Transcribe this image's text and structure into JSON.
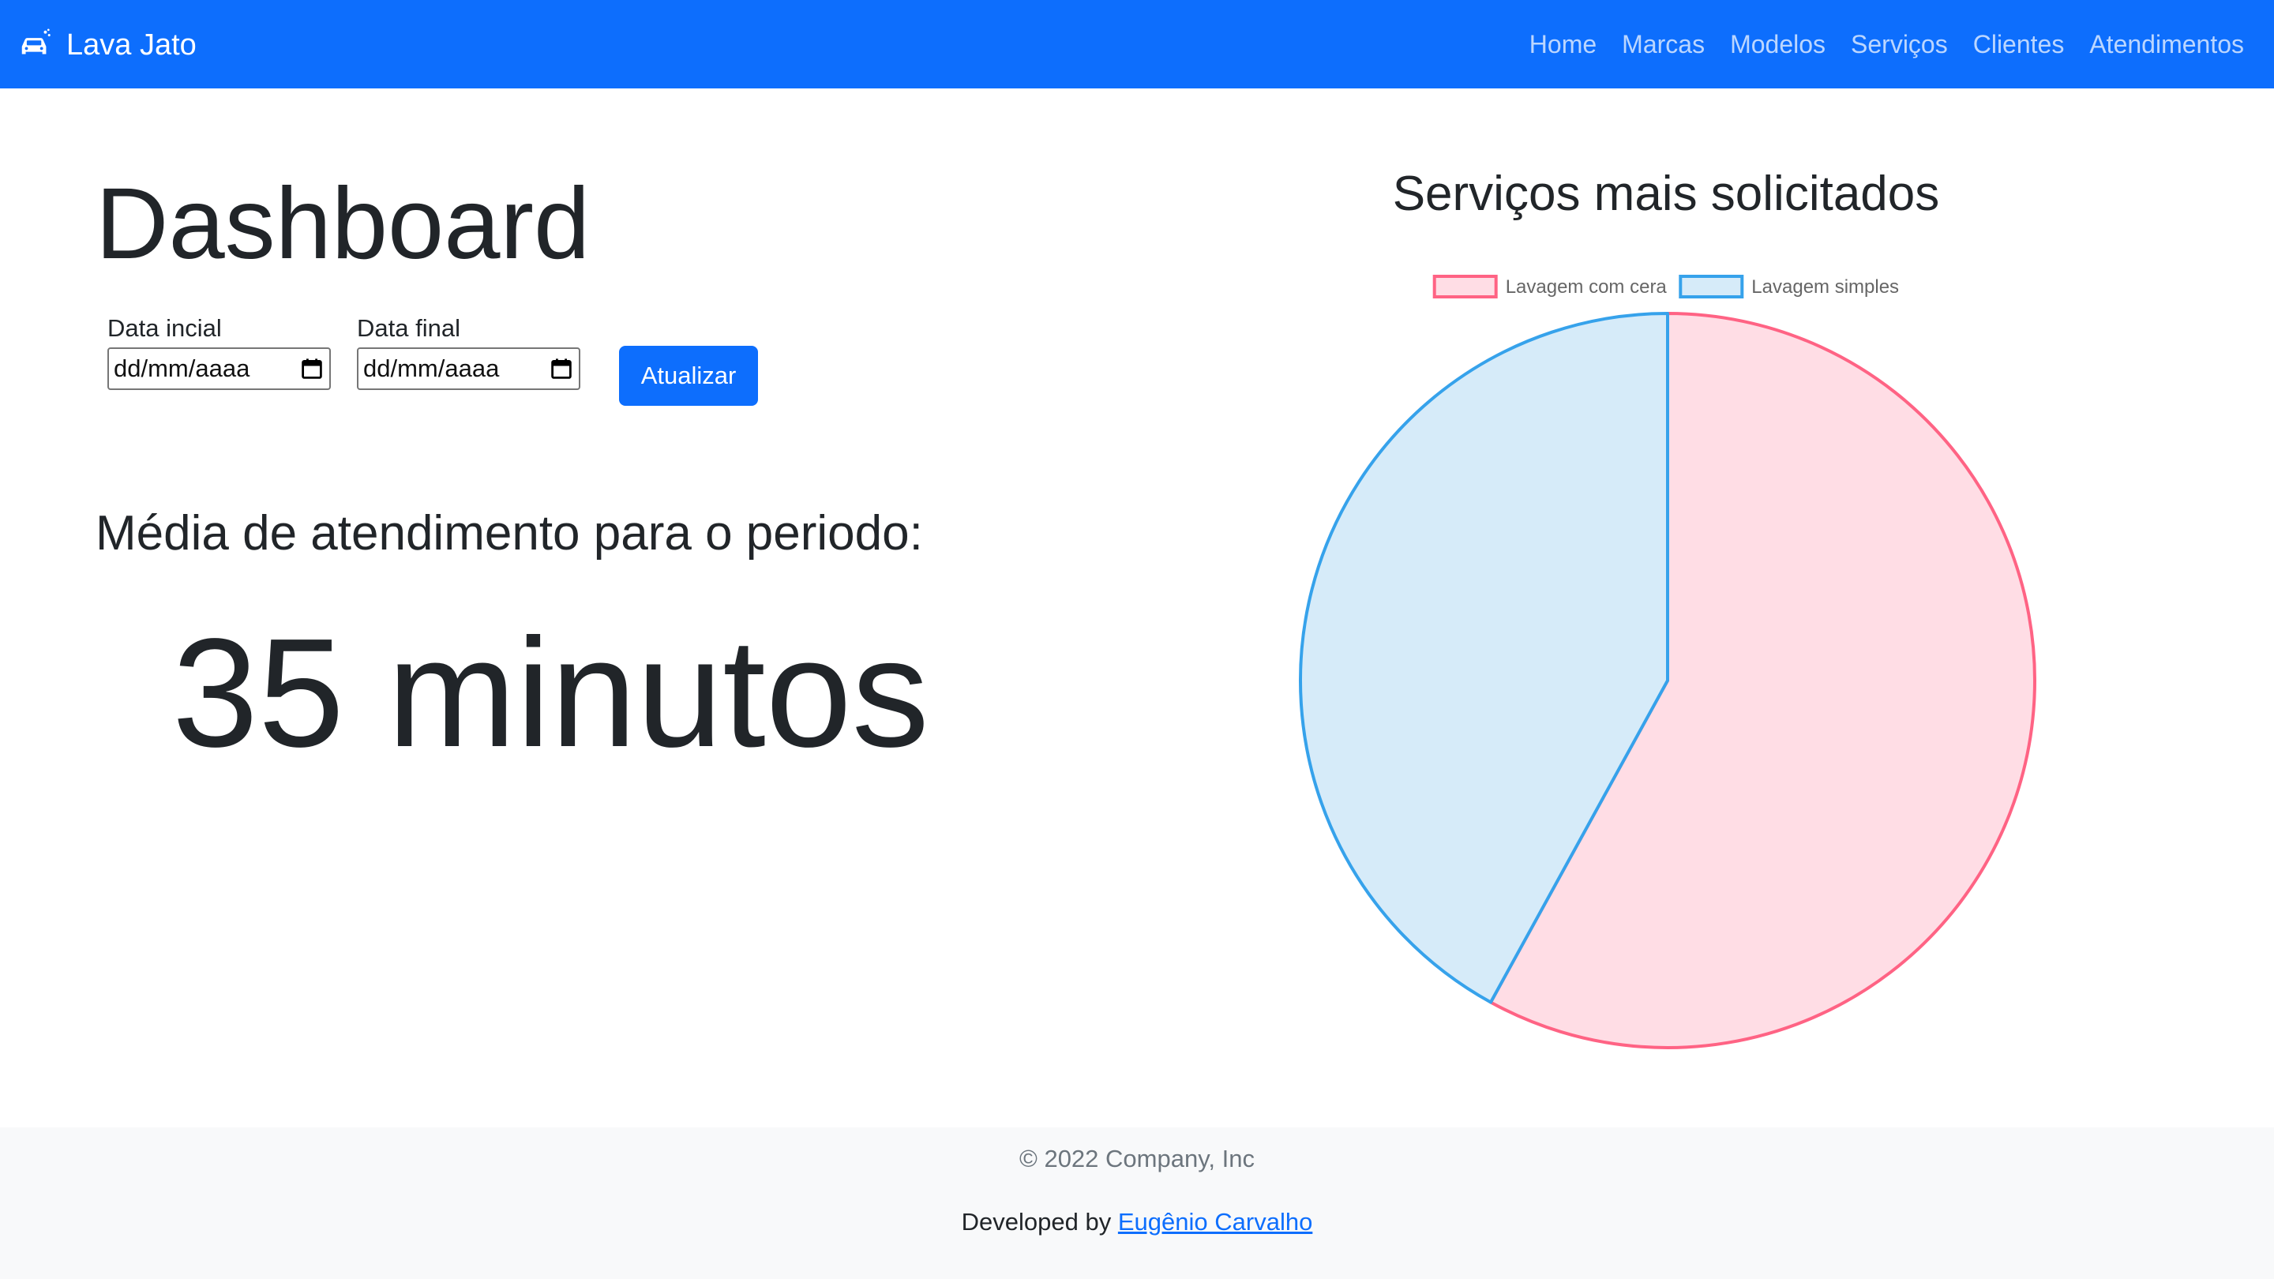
{
  "navbar": {
    "brand": "Lava Jato",
    "brand_icon": "car-wash-icon",
    "links": [
      "Home",
      "Marcas",
      "Modelos",
      "Serviços",
      "Clientes",
      "Atendimentos"
    ],
    "color": "#0d6efd"
  },
  "dashboard": {
    "title": "Dashboard",
    "start_label": "Data incial",
    "start_value": "dd/mm/aaaa",
    "end_label": "Data final",
    "end_value": "dd/mm/aaaa",
    "calendar_icon": "calendar-icon",
    "update_button": "Atualizar",
    "avg_label": "Média de atendimento para o periodo:",
    "avg_value": "35 minutos"
  },
  "chart_data": {
    "type": "pie",
    "title": "Serviços mais solicitados",
    "legend_position": "top",
    "categories": [
      "Lavagem com cera",
      "Lavagem simples"
    ],
    "values": [
      58,
      42
    ],
    "fill_colors": [
      "#ffdde5",
      "#d6ebf9"
    ],
    "border_colors": [
      "#ff6384",
      "#36a2eb"
    ]
  },
  "footer": {
    "copyright": "© 2022 Company, Inc",
    "developed_by": "Developed by",
    "author": "Eugênio Carvalho"
  }
}
